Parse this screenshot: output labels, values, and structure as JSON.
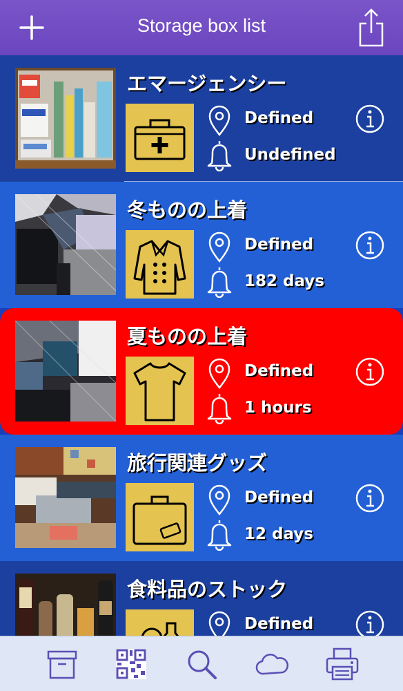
{
  "nav": {
    "title": "Storage box list",
    "add_icon": "plus-icon",
    "share_icon": "share-icon"
  },
  "boxes": [
    {
      "name": "エマージェンシー",
      "location": "Defined",
      "reminder": "Undefined",
      "category_icon": "first-aid-kit-icon",
      "photo": "medicine-drawer"
    },
    {
      "name": "冬ものの上着",
      "location": "Defined",
      "reminder": "182 days",
      "category_icon": "coat-icon",
      "photo": "winter-clothes"
    },
    {
      "name": "夏ものの上着",
      "location": "Defined",
      "reminder": "1 hours",
      "category_icon": "t-shirt-icon",
      "photo": "summer-clothes",
      "highlight": "#ff0000"
    },
    {
      "name": "旅行関連グッズ",
      "location": "Defined",
      "reminder": "12 days",
      "category_icon": "suitcase-icon",
      "photo": "travel-goods"
    },
    {
      "name": "食料品のストック",
      "location": "Defined",
      "reminder": "",
      "category_icon": "food-bottle-icon",
      "photo": "food-stock"
    }
  ],
  "tabbar": [
    "box-icon",
    "qr-code-icon",
    "search-icon",
    "cloud-icon",
    "printer-icon"
  ],
  "colors": {
    "navbar": "#6b45bf",
    "row_dark": "#1b40a0",
    "row_mid": "#2360d6",
    "alert": "#ff0000",
    "category_tile": "#e5c350",
    "tabbar_icon": "#5a4fb5"
  }
}
